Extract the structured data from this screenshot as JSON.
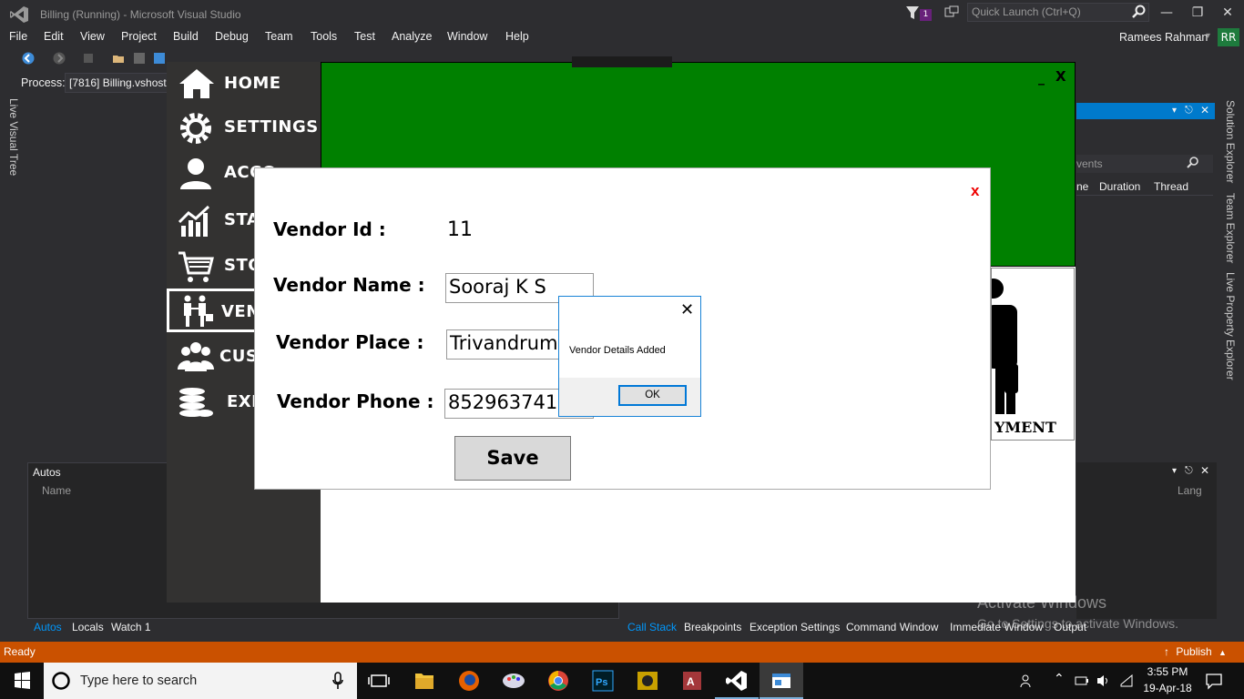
{
  "vs": {
    "title": "Billing (Running) - Microsoft Visual Studio",
    "notification_count": "1",
    "quick_launch_placeholder": "Quick Launch (Ctrl+Q)",
    "menu": [
      "File",
      "Edit",
      "View",
      "Project",
      "Build",
      "Debug",
      "Team",
      "Tools",
      "Test",
      "Analyze",
      "Window",
      "Help"
    ],
    "user_name": "Ramees Rahman",
    "user_initials": "RR",
    "process_label": "Process:",
    "process_value": "[7816] Billing.vshost.",
    "left_tab": "Live Visual Tree",
    "right_tabs": [
      "Solution Explorer",
      "Team Explorer",
      "Live Property Explorer"
    ],
    "diag_search": "vents",
    "diag_columns": [
      "ne",
      "Duration",
      "Thread"
    ],
    "autos_title": "Autos",
    "autos_name_col": "Name",
    "lang_col": "Lang",
    "bottom_left_tabs": [
      "Autos",
      "Locals",
      "Watch 1"
    ],
    "bottom_right_tabs": [
      "Call Stack",
      "Breakpoints",
      "Exception Settings",
      "Command Window",
      "Immediate Window",
      "Output"
    ],
    "status": "Ready",
    "publish": "Publish",
    "activate_line1": "Activate Windows",
    "activate_line2": "Go to Settings to activate Windows."
  },
  "taskbar": {
    "search_placeholder": "Type here to search",
    "time": "3:55 PM",
    "date": "19-Apr-18"
  },
  "app": {
    "nav": [
      "HOME",
      "SETTINGS",
      "ACCOUNTS",
      "STATISTICS",
      "STOCK",
      "VENDOR",
      "CUSTOMER",
      "EXPENSE"
    ],
    "nav_visible": [
      "HOME",
      "SETTINGS",
      "ACCO",
      "STAT",
      "STO",
      "VEN",
      "CUST",
      "EXP"
    ],
    "minimize": "_",
    "close": "X",
    "payment_label": "YMENT"
  },
  "vendor_form": {
    "close": "x",
    "id_label": "Vendor Id :",
    "id_value": "11",
    "name_label": "Vendor Name :",
    "name_value": "Sooraj K S",
    "place_label": "Vendor Place :",
    "place_value": "Trivandrum",
    "phone_label": "Vendor Phone :",
    "phone_value": "8529637412",
    "save_label": "Save"
  },
  "message_box": {
    "text": "Vendor Details Added",
    "ok_label": "OK",
    "close": "✕"
  },
  "colors": {
    "vs_background": "#2d2d30",
    "status_bar": "#ca5100",
    "app_header_green": "#008000",
    "accent": "#007acc"
  }
}
